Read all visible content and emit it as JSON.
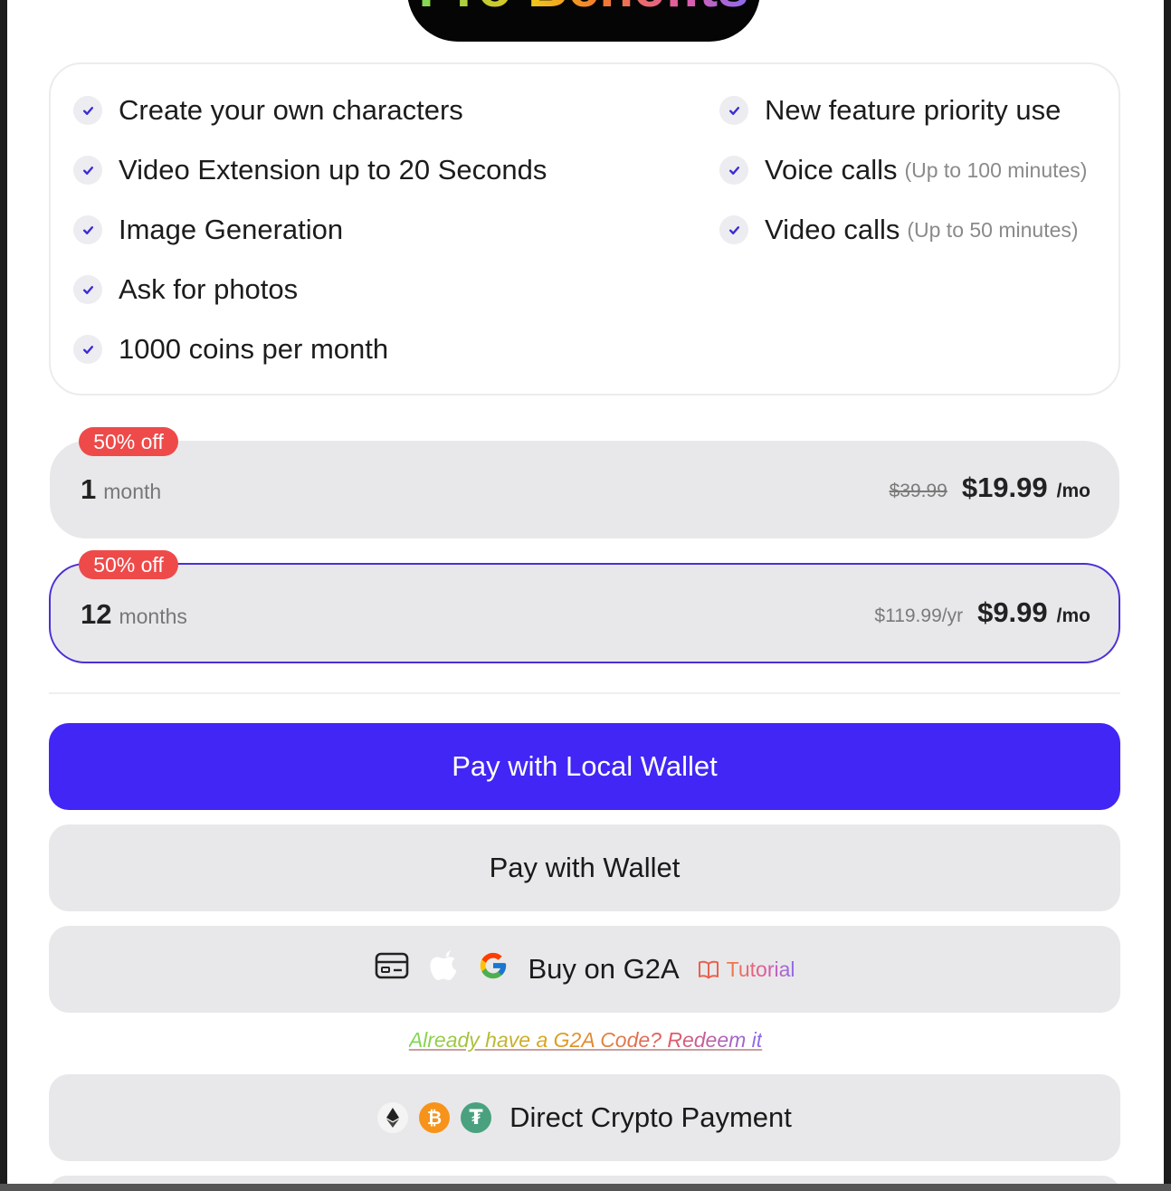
{
  "title": "Pro Benefits",
  "benefits": {
    "left": [
      {
        "label": "Create your own characters"
      },
      {
        "label": "Video Extension up to 20 Seconds"
      },
      {
        "label": "Image Generation"
      },
      {
        "label": "Ask for photos"
      },
      {
        "label": "1000 coins per month"
      }
    ],
    "right": [
      {
        "label": "New feature priority use",
        "note": ""
      },
      {
        "label": "Voice calls",
        "note": "(Up to 100 minutes)"
      },
      {
        "label": "Video calls",
        "note": "(Up to 50 minutes)"
      }
    ]
  },
  "plans": [
    {
      "badge": "50% off",
      "num": "1",
      "unit": "month",
      "original": "$39.99",
      "price": "$19.99",
      "per": "/mo",
      "selected": false
    },
    {
      "badge": "50% off",
      "num": "12",
      "unit": "months",
      "original": "$119.99/yr",
      "price": "$9.99",
      "per": "/mo",
      "selected": true
    }
  ],
  "buttons": {
    "local_wallet": "Pay with Local Wallet",
    "wallet": "Pay with Wallet",
    "g2a": "Buy on G2A",
    "tutorial": "Tutorial",
    "redeem": "Already have a G2A Code? Redeem it",
    "crypto": "Direct Crypto Payment"
  },
  "colors": {
    "primary": "#4226f5",
    "badge": "#ee4a4a",
    "selected_border": "#4b2fd6",
    "check": "#3b2bd4"
  },
  "icons": {
    "g2a_row": [
      "card-icon",
      "apple-icon",
      "google-icon"
    ],
    "tutorial": "book-icon",
    "crypto_row": [
      "ethereum-icon",
      "bitcoin-icon",
      "tether-icon"
    ],
    "benefit": "check-icon"
  }
}
